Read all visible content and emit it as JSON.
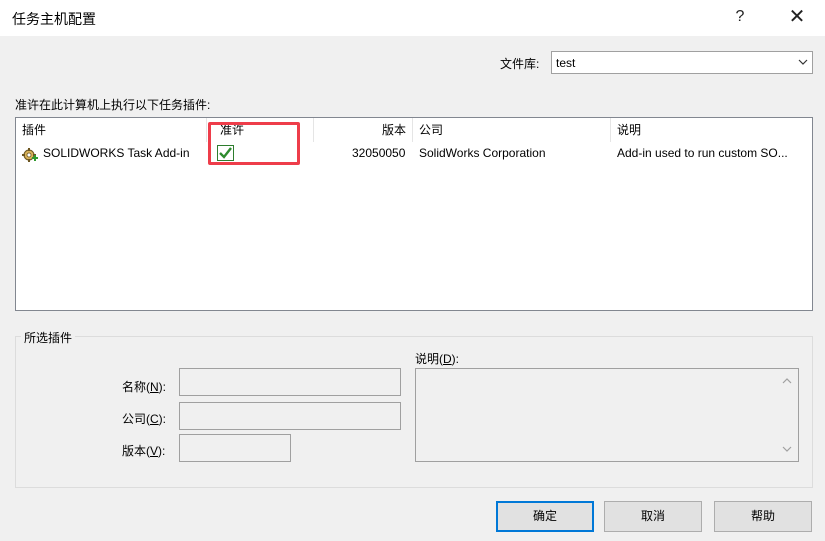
{
  "window": {
    "title": "任务主机配置",
    "help_glyph": "?",
    "close_glyph": "✕"
  },
  "library": {
    "label": "文件库:",
    "value": "test"
  },
  "plugin_list": {
    "caption": "准许在此计算机上执行以下任务插件:",
    "columns": [
      "插件",
      "准许",
      "版本",
      "公司",
      "说明"
    ],
    "rows": [
      {
        "name": "SOLIDWORKS Task Add-in",
        "allowed": true,
        "version": "32050050",
        "company": "SolidWorks Corporation",
        "description": "Add-in used to run custom SO..."
      }
    ]
  },
  "selected_plugin": {
    "group_title": "所选插件",
    "name_label_prefix": "名称(",
    "name_label_key": "N",
    "name_label_suffix": "):",
    "company_label_prefix": "公司(",
    "company_label_key": "C",
    "company_label_suffix": "):",
    "version_label_prefix": "版本(",
    "version_label_key": "V",
    "version_label_suffix": "):",
    "desc_label_prefix": "说明(",
    "desc_label_key": "D",
    "desc_label_suffix": "):",
    "name_value": "",
    "company_value": "",
    "version_value": "",
    "desc_value": ""
  },
  "buttons": {
    "ok": "确定",
    "cancel": "取消",
    "help": "帮助"
  },
  "colors": {
    "highlight": "#ee3d4a",
    "default_button_border": "#0078d7",
    "check_green": "#2e8b2e"
  },
  "icons": {
    "plugin": "gear-plus-icon",
    "checkbox": "check-icon",
    "dropdown": "chevron-down-icon"
  }
}
